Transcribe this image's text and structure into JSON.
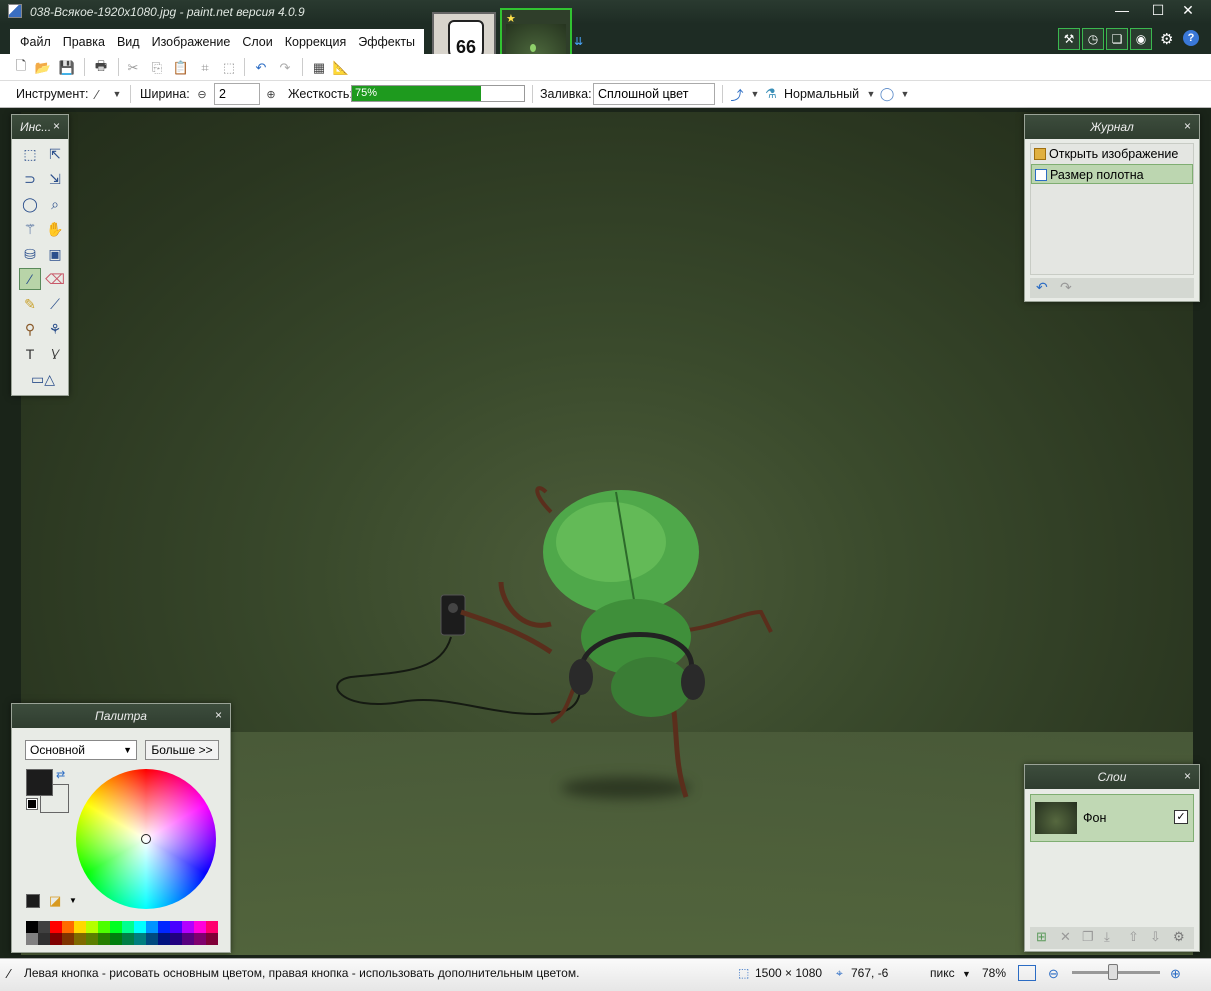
{
  "window": {
    "title": "038-Всякое-1920x1080.jpg - paint.net версия 4.0.9",
    "minimize": "—",
    "maximize": "☐",
    "close": "✕"
  },
  "menu": [
    "Файл",
    "Правка",
    "Вид",
    "Изображение",
    "Слои",
    "Коррекция",
    "Эффекты"
  ],
  "image_tabs": {
    "tab1_text": "66",
    "tab2_marker": "★",
    "overflow": "⇊"
  },
  "toolbar2": {
    "tool_label": "Инструмент:",
    "width_label": "Ширина:",
    "width_value": "2",
    "hardness_label": "Жесткость:",
    "hardness_value": "75%",
    "hardness_fraction": 0.75,
    "fill_label": "Заливка:",
    "fill_value": "Сплошной цвет",
    "blend_value": "Нормальный"
  },
  "panels": {
    "tools": {
      "title": "Инс..."
    },
    "history": {
      "title": "Журнал",
      "items": [
        "Открыть изображение",
        "Размер полотна"
      ],
      "selected_index": 1
    },
    "palette": {
      "title": "Палитра",
      "select_value": "Основной",
      "more_button": "Больше >>"
    },
    "layers": {
      "title": "Слои",
      "layer_name": "Фон",
      "visible": "✓"
    },
    "close_glyph": "×"
  },
  "status": {
    "hint": "Левая кнопка - рисовать основным цветом, правая кнопка - использовать дополнительным цветом.",
    "image_size": "1500 × 1080",
    "cursor_pos": "767, -6",
    "units": "пикс",
    "zoom": "78%"
  },
  "colors": {
    "accent_green": "#1e9a1e",
    "primary_color": "#1c1c1c",
    "selected_bg": "#bcd6b0"
  },
  "palette_swatches": [
    "#000000",
    "#404040",
    "#ff0000",
    "#ff6a00",
    "#ffd800",
    "#b6ff00",
    "#4cff00",
    "#00ff21",
    "#00ff90",
    "#00ffff",
    "#0094ff",
    "#0026ff",
    "#4800ff",
    "#b200ff",
    "#ff00dc",
    "#ff006e",
    "#808080",
    "#303030",
    "#7f0000",
    "#7f3300",
    "#7f6a00",
    "#5b7f00",
    "#267f00",
    "#007f0e",
    "#007f46",
    "#007f7f",
    "#004a7f",
    "#00137f",
    "#21007f",
    "#57007f",
    "#7f006e",
    "#7f0037"
  ]
}
